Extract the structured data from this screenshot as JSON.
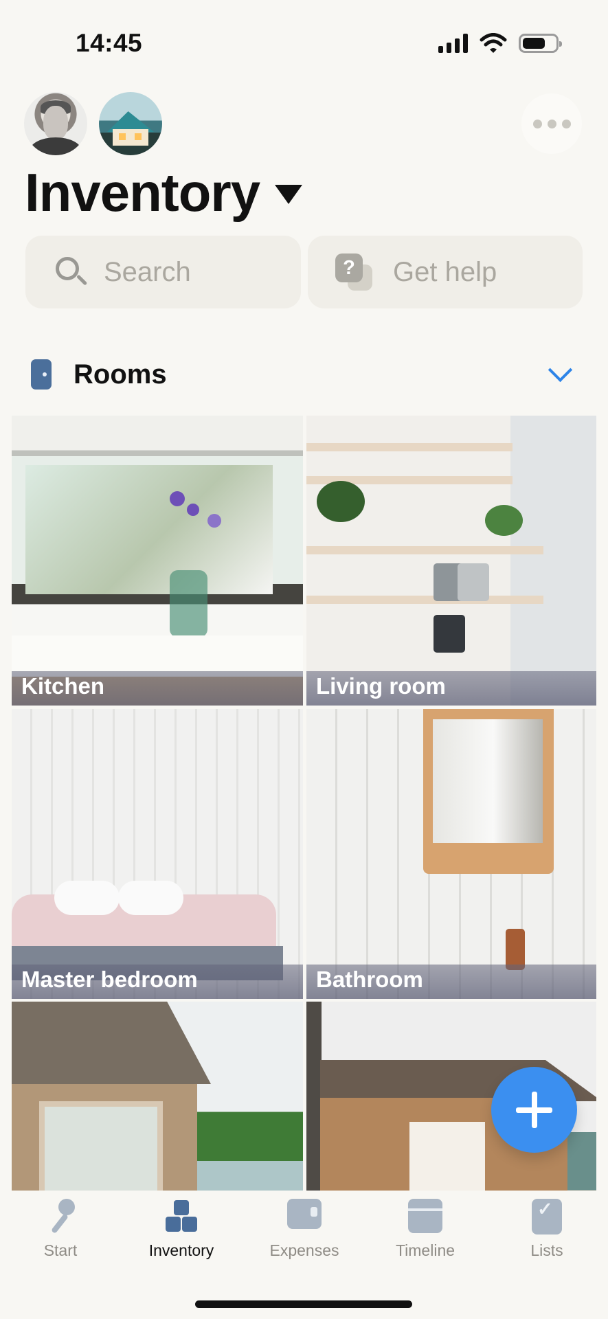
{
  "status": {
    "time": "14:45",
    "signal_icon": "cellular-signal-icon",
    "wifi_icon": "wifi-icon",
    "battery_icon": "battery-icon"
  },
  "header": {
    "title": "Inventory",
    "dropdown_icon": "triangle-down-icon",
    "more_icon": "ellipsis-icon",
    "avatars": [
      {
        "type": "user",
        "icon": "user-avatar"
      },
      {
        "type": "home",
        "icon": "home-avatar"
      }
    ]
  },
  "search": {
    "placeholder": "Search",
    "icon": "search-icon"
  },
  "help": {
    "label": "Get help",
    "icon": "help-icon"
  },
  "rooms": {
    "title": "Rooms",
    "icon": "door-icon",
    "toggle_icon": "chevron-down-icon",
    "items": [
      {
        "label": "Kitchen"
      },
      {
        "label": "Living room"
      },
      {
        "label": "Master bedroom"
      },
      {
        "label": "Bathroom"
      },
      {
        "label": ""
      },
      {
        "label": ""
      }
    ]
  },
  "fab": {
    "icon": "plus-icon",
    "color": "#3b8ff0"
  },
  "tabs": [
    {
      "label": "Start",
      "icon": "key-icon"
    },
    {
      "label": "Inventory",
      "icon": "boxes-icon",
      "active": true
    },
    {
      "label": "Expenses",
      "icon": "wallet-icon"
    },
    {
      "label": "Timeline",
      "icon": "calendar-icon"
    },
    {
      "label": "Lists",
      "icon": "checklist-icon"
    }
  ],
  "colors": {
    "background": "#f8f7f3",
    "accent": "#2d84e8",
    "icon_muted": "#a9b5c3",
    "active_icon": "#496d9a"
  }
}
